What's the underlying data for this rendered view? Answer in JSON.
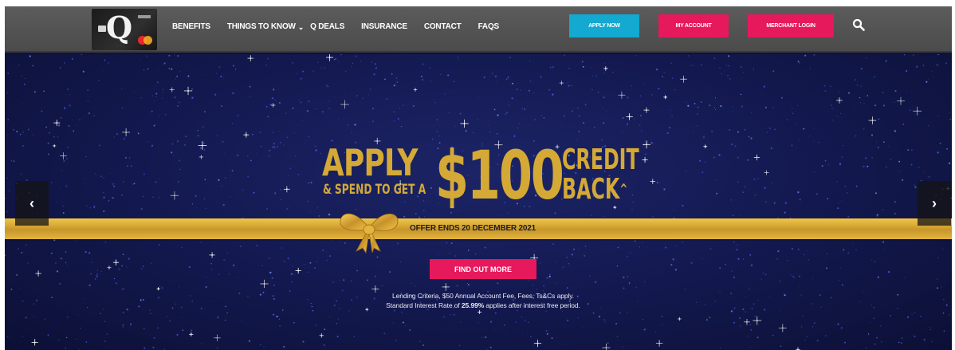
{
  "nav": {
    "logo_letter": "Q",
    "links": {
      "benefits": "BENEFITS",
      "things_to_know": "THINGS TO KNOW",
      "q_deals": "Q DEALS",
      "insurance": "INSURANCE",
      "contact": "CONTACT",
      "faqs": "FAQS"
    },
    "buttons": {
      "apply_now": "APPLY NOW",
      "my_account": "MY ACCOUNT",
      "merchant_login": "MERCHANT LOGIN"
    },
    "icons": {
      "dropdown": "chevron-down-icon",
      "search": "search-icon"
    }
  },
  "hero": {
    "apply": "APPLY",
    "spend_line": "& SPEND TO GET A",
    "amount": "$100",
    "credit": "CREDIT",
    "back": "BACK",
    "back_mark": "^",
    "offer": "OFFER ENDS 20 DECEMBER 2021",
    "cta": "FIND OUT MORE",
    "legal_line1": "Lending Criteria, $50 Annual Account Fee, Fees, Ts&Cs apply.",
    "legal_line2_prefix": "Standard Interest Rate of ",
    "legal_rate": "25.99%",
    "legal_line2_suffix": " applies after interest free period.",
    "prev_arrow": "‹",
    "next_arrow": "›"
  },
  "colors": {
    "nav_bg": "#555555",
    "apply_button": "#13a9d0",
    "pink_button": "#e6195c",
    "gold": "#d4a935",
    "hero_bg": "#141a52"
  }
}
